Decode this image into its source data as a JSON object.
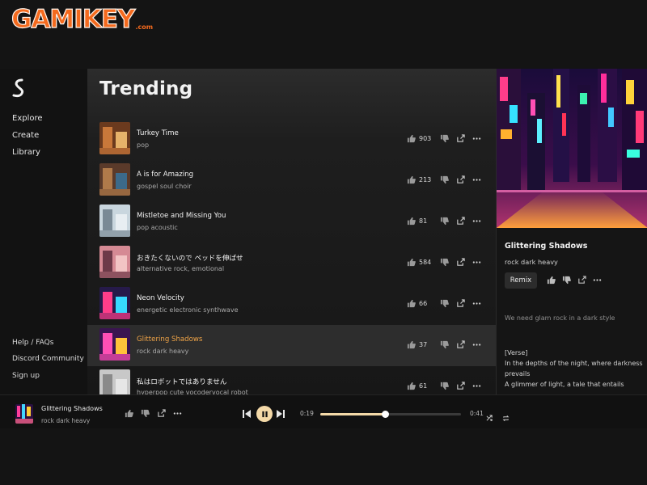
{
  "watermark": {
    "text": "GAMIKEY",
    "suffix": ".com"
  },
  "sidebar": {
    "nav": [
      "Explore",
      "Create",
      "Library"
    ],
    "bottom": [
      "Help / FAQs",
      "Discord Community",
      "Sign up"
    ]
  },
  "main": {
    "title": "Trending",
    "songs": [
      {
        "title": "Turkey Time",
        "tags": "pop",
        "likes": "903"
      },
      {
        "title": "A is for Amazing",
        "tags": "gospel soul choir",
        "likes": "213"
      },
      {
        "title": "Mistletoe and Missing You",
        "tags": "pop acoustic",
        "likes": "81"
      },
      {
        "title": "おきたくないので ベッドを伸ばせ",
        "tags": "alternative rock, emotional",
        "likes": "584"
      },
      {
        "title": "Neon Velocity",
        "tags": "energetic electronic synthwave",
        "likes": "66"
      },
      {
        "title": "Glittering Shadows",
        "tags": "rock dark heavy",
        "likes": "37"
      },
      {
        "title": "私はロボットではありません",
        "tags": "hyperpop cute vocodervocal robot",
        "likes": "61"
      }
    ],
    "active_index": 5
  },
  "detail": {
    "title": "Glittering Shadows",
    "tags": "rock dark heavy",
    "remix_label": "Remix",
    "prompt": "We need glam rock in a dark style",
    "lyrics": [
      "[Verse]",
      "In the depths of the night, where darkness prevails",
      "A glimmer of light, a tale that entails"
    ]
  },
  "player": {
    "title": "Glittering Shadows",
    "tags": "rock dark heavy",
    "current_time": "0:19",
    "duration": "0:41",
    "progress": 0.46
  },
  "colors": {
    "accent": "#f0a447",
    "play_button": "#f4d9a8",
    "logo": "#f46a1e"
  },
  "icons": [
    "thumbs-up-icon",
    "thumbs-down-icon",
    "share-icon",
    "more-icon",
    "prev-icon",
    "pause-icon",
    "next-icon",
    "shuffle-icon",
    "repeat-icon"
  ]
}
